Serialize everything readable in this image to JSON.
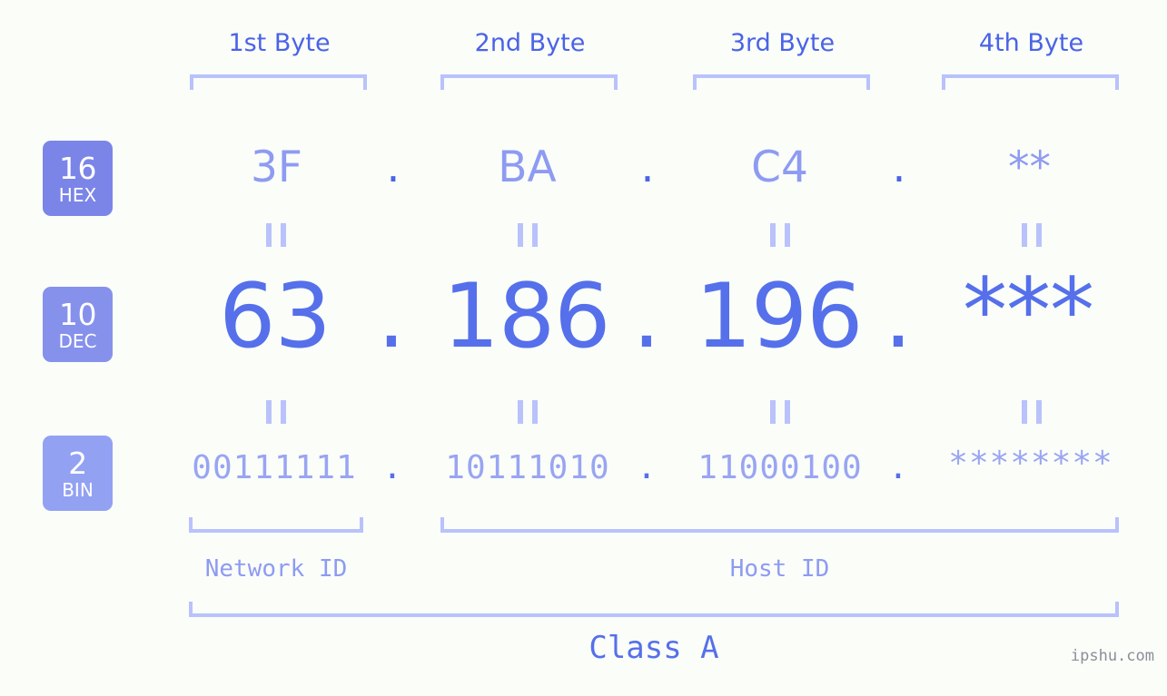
{
  "background_color": "#fbfdf9",
  "colors": {
    "header_blue": "#4a63e7",
    "bracket_blue": "#b9c2fb",
    "hex_value_blue": "#8e9bf2",
    "dec_value_blue": "#5570ea",
    "bin_value_blue": "#99a5f2",
    "badge_hex": "#7b85e8",
    "badge_dec": "#8691ec",
    "badge_bin": "#93a1f3",
    "watermark_gray": "#8a8f99"
  },
  "headers": {
    "byte_labels": [
      "1st Byte",
      "2nd Byte",
      "3rd Byte",
      "4th Byte"
    ]
  },
  "badges": [
    {
      "num": "16",
      "sub": "HEX",
      "color": "#7b85e8"
    },
    {
      "num": "10",
      "sub": "DEC",
      "color": "#8691ec"
    },
    {
      "num": "2",
      "sub": "BIN",
      "color": "#93a1f3"
    }
  ],
  "rows": {
    "hex": {
      "radix": "16",
      "radix_name": "HEX",
      "values": [
        "3F",
        "BA",
        "C4",
        "**"
      ],
      "separator": "."
    },
    "dec": {
      "radix": "10",
      "radix_name": "DEC",
      "values": [
        "63",
        "186",
        "196",
        "***"
      ],
      "separator": "."
    },
    "bin": {
      "radix": "2",
      "radix_name": "BIN",
      "values": [
        "00111111",
        "10111010",
        "11000100",
        "********"
      ],
      "separator": "."
    }
  },
  "connector": "||",
  "footer": {
    "network_id_label": "Network ID",
    "host_id_label": "Host ID",
    "class_label": "Class A",
    "watermark": "ipshu.com"
  }
}
